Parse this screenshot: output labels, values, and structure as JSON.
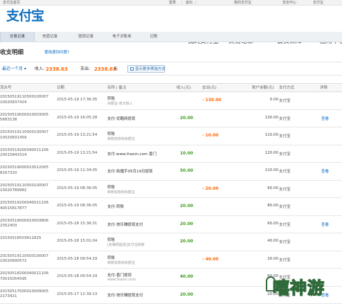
{
  "topbar": {
    "items": [
      "支付宝首页",
      "登录",
      "|",
      "退出",
      "|",
      "我的支付宝",
      "安全中心",
      "支付宝"
    ]
  },
  "logo": {
    "text": "支付宝"
  },
  "nav": {
    "items": [
      {
        "label": "我的支付宝",
        "active": false
      },
      {
        "label": "交易记录",
        "active": true
      },
      {
        "label": "会员保障",
        "active": false
      },
      {
        "label": "应用中心",
        "active": false
      }
    ]
  },
  "tabs": [
    {
      "label": "交易记录",
      "active": true
    },
    {
      "label": "充值记录",
      "active": false
    },
    {
      "label": "提现记录",
      "active": false
    },
    {
      "label": "电子对账单",
      "active": false
    },
    {
      "label": "记账",
      "active": false
    }
  ],
  "page": {
    "title": "收支明细",
    "link": "使用遇到问题?"
  },
  "filter": {
    "range": "最近一个月 ▾",
    "income_label": "收入:",
    "income_value": "2338.63",
    "expense_label": "支出:",
    "expense_value": "2338.63",
    "unit": "元",
    "more_button": "显示更多筛选方式"
  },
  "table": {
    "headers": [
      "流水号",
      "日期",
      "名称 | 备注",
      "收入(元)",
      "支出(元)",
      "账户余额(元)",
      "支付方式",
      "详情"
    ],
    "rows": [
      {
        "serial": [
          "20150519110500100007",
          "10020837424"
        ],
        "date": "2015-05-19 17:36:35",
        "name": "转账",
        "note": "余额宝-单次转入",
        "income": "",
        "expense": "- 130.00",
        "balance": "0.00",
        "method": "支付宝",
        "detail": ""
      },
      {
        "serial": [
          "20150519000010003005",
          "5683138"
        ],
        "date": "2015-05-19 16:05:28",
        "name": "支付-优酷网提现",
        "note": "",
        "income": "20.00",
        "expense": "",
        "balance": "130.00",
        "method": "支付宝",
        "detail": "查看"
      },
      {
        "serial": [
          "20150519110500100007",
          "10020831459"
        ],
        "date": "2015-05-19 13:21:54",
        "name": "转账",
        "note": "转账收款到余额宝",
        "income": "",
        "expense": "- 10.00",
        "balance": "110.00",
        "method": "支付宝",
        "detail": ""
      },
      {
        "serial": [
          "20150519200040011106",
          "20015843314"
        ],
        "date": "2015-05-19 13:21:54",
        "name": "支付-www.ihaom.com 香门",
        "note": "",
        "income": "10.00",
        "expense": "",
        "balance": "120.00",
        "method": "支付宝",
        "detail": ""
      },
      {
        "serial": [
          "20150519000010012005",
          "8167320"
        ],
        "date": "2015-05-19 11:34:05",
        "name": "支付-街播手05月19日提现",
        "note": "",
        "income": "50.00",
        "expense": "",
        "balance": "110.00",
        "method": "支付宝",
        "detail": "查看"
      },
      {
        "serial": [
          "20150519110500100007",
          "10020789982"
        ],
        "date": "2015-05-19 08:36:05",
        "name": "转账",
        "note": "转账收款到余额宝",
        "income": "",
        "expense": "- 20.00",
        "balance": "60.00",
        "method": "支付宝",
        "detail": ""
      },
      {
        "serial": [
          "20150519200040011106",
          "40015817877"
        ],
        "date": "2015-05-19 08:36:05",
        "name": "支付-转账",
        "note": "",
        "income": "20.00",
        "expense": "",
        "balance": "80.00",
        "method": "支付宝",
        "detail": ""
      },
      {
        "serial": [
          "20150519000010003806",
          "2352403"
        ],
        "date": "2015-05-18 15:36:31",
        "name": "支付-快乐赚提现支付",
        "note": "",
        "income": "20.00",
        "expense": "",
        "balance": "60.00",
        "method": "支付宝",
        "detail": "查看"
      },
      {
        "serial": [
          "20150518503611825",
          ""
        ],
        "date": "2015-05-18 15:01:04",
        "name": "转账",
        "note": "[有赚网提现]支付宝转账",
        "income": "20.00",
        "expense": "",
        "balance": "40.00",
        "method": "支付宝",
        "detail": ""
      },
      {
        "serial": [
          "20150519110500100007",
          "10020690572"
        ],
        "date": "2015-05-18 09:54:19",
        "name": "转账",
        "note": "转账收款到余额宝",
        "income": "",
        "expense": "- 40.00",
        "balance": "20.00",
        "method": "支付宝",
        "detail": ""
      },
      {
        "serial": [
          "20150518200040011106",
          "70015054595"
        ],
        "date": "2015-05-18 09:54:19",
        "name": "支付-香门提现",
        "note": "www.ihaom.com",
        "income": "40.00",
        "expense": "",
        "balance": "60.00",
        "method": "支付宝",
        "detail": ""
      },
      {
        "serial": [
          "20150517000010009005",
          "2173421"
        ],
        "date": "2015-05-17 12:39:13",
        "name": "支付-快乐赚提现支付",
        "note": "",
        "income": "20.00",
        "expense": "",
        "balance": "20.00",
        "method": "支付宝",
        "detail": "查看"
      }
    ]
  },
  "watermark": {
    "text": "嘻神游"
  },
  "colors": {
    "accent": "#ff6600",
    "brand": "#0f6fbf",
    "income": "#3e9b1c",
    "link": "#0e6bc1"
  }
}
